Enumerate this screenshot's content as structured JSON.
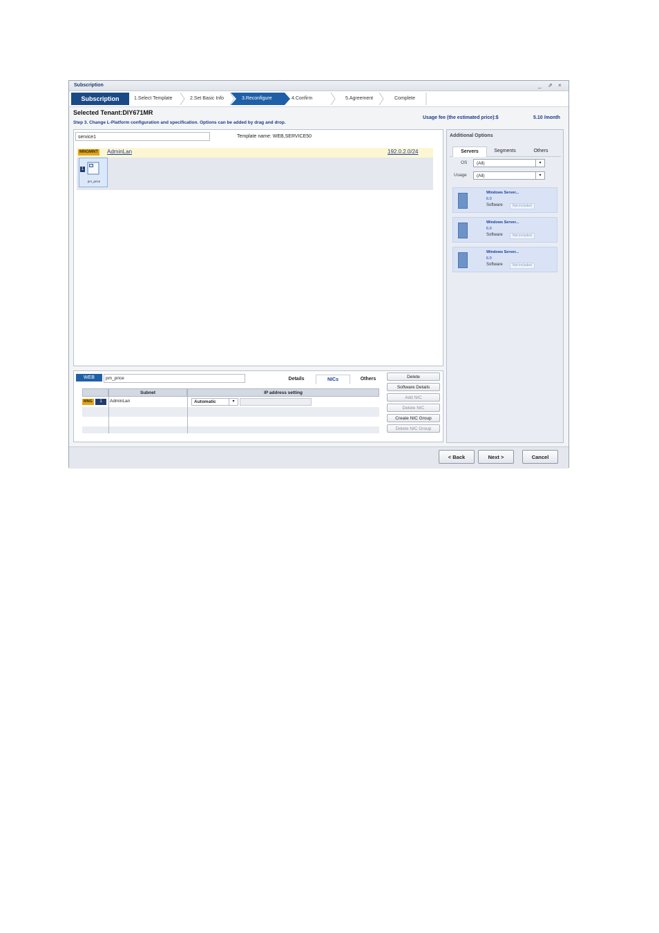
{
  "window": {
    "title": "Subscription",
    "controls": [
      "_",
      "⇗",
      "×"
    ]
  },
  "wizard": {
    "title": "Subscription",
    "steps": [
      "1.Select Template",
      "2.Set Basic Info",
      "3.Reconfigure",
      "4.Confirm",
      "5.Agreement",
      "Complete"
    ],
    "active_step": "3.Reconfigure"
  },
  "header": {
    "tenant": "Selected Tenant:DIY671MR",
    "step_desc": "Step 3. Change L-Platform configuration and specification. Options can be added by drag and drop.",
    "usage_fee_label": "Usage fee (the estimated price):$",
    "usage_fee_value": "5.10 /month"
  },
  "canvas": {
    "service_name": "service1",
    "template_name": "Template name: WEB,SERVICE50",
    "segment": {
      "badge": "MNGMNT",
      "name": "AdminLan",
      "cidr": "192.0.2.0/24"
    },
    "server": {
      "num": "1",
      "name": "pm_price"
    }
  },
  "detail": {
    "role": "WEB",
    "server_name": "pm_price",
    "tabs": [
      "Details",
      "NICs",
      "Others"
    ],
    "active_tab": "NICs",
    "grid": {
      "headers": [
        "Subnet",
        "IP address setting"
      ],
      "rows": [
        {
          "badge": "MNG",
          "num": "1",
          "subnet": "AdminLan",
          "ip_setting": "Automatic"
        }
      ]
    },
    "buttons": [
      {
        "label": "Delete",
        "enabled": true
      },
      {
        "label": "Software Details",
        "enabled": true
      },
      {
        "label": "Add NIC",
        "enabled": false
      },
      {
        "label": "Delete NIC",
        "enabled": false
      },
      {
        "label": "Create NIC Group",
        "enabled": true
      },
      {
        "label": "Delete NIC Group",
        "enabled": false
      }
    ]
  },
  "additional_options": {
    "title": "Additional Options",
    "tabs": [
      "Servers",
      "Segments",
      "Others"
    ],
    "active_tab": "Servers",
    "os_label": "OS",
    "os_value": "(All)",
    "usage_label": "Usage",
    "usage_value": "(All)",
    "cards": [
      {
        "name": "Windows Server...",
        "version": "6.0",
        "software": "Software",
        "status": "Not included"
      },
      {
        "name": "Windows Server...",
        "version": "6.0",
        "software": "Software",
        "status": "Not included"
      },
      {
        "name": "Windows Server...",
        "version": "6.0",
        "software": "Software",
        "status": "Not included"
      }
    ]
  },
  "footer": {
    "back": "< Back",
    "next": "Next >",
    "cancel": "Cancel"
  }
}
